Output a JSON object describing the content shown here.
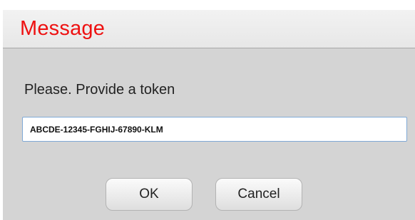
{
  "dialog": {
    "title": "Message",
    "prompt": "Please. Provide a token",
    "token_value": "ABCDE-12345-FGHIJ-67890-KLM",
    "buttons": {
      "ok_label": "OK",
      "cancel_label": "Cancel"
    },
    "colors": {
      "title": "#ee1111",
      "body_background": "#d4d4d4",
      "header_background": "#eeeeee",
      "input_border": "#7fa9d6"
    }
  }
}
